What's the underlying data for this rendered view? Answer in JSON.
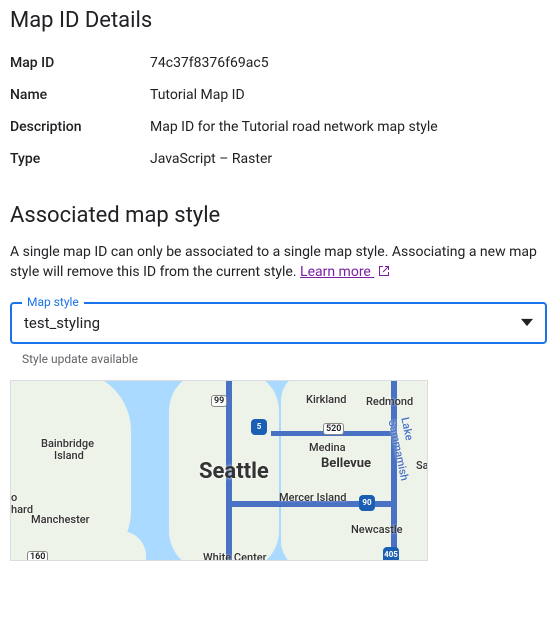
{
  "details": {
    "title": "Map ID Details",
    "rows": [
      {
        "label": "Map ID",
        "value": "74c37f8376f69ac5"
      },
      {
        "label": "Name",
        "value": "Tutorial Map ID"
      },
      {
        "label": "Description",
        "value": "Map ID for the Tutorial road network map style"
      },
      {
        "label": "Type",
        "value": "JavaScript – Raster"
      }
    ]
  },
  "associated": {
    "title": "Associated map style",
    "description": "A single map ID can only be associated to a single map style. Associating a new map style will remove this ID from the current style.",
    "learn_more": "Learn more",
    "select_legend": "Map style",
    "select_value": "test_styling",
    "helper": "Style update available"
  },
  "map": {
    "cities": {
      "seattle": "Seattle",
      "bellevue": "Bellevue",
      "kirkland": "Kirkland",
      "redmond": "Redmond",
      "medina": "Medina",
      "mercer": "Mercer Island",
      "newcastle": "Newcastle",
      "bainbridge1": "Bainbridge",
      "bainbridge2": "Island",
      "manchester": "Manchester",
      "whitecenter": "White Center",
      "sammamish": "Lake Sammamish",
      "hard": "hard",
      "o": "o",
      "sa": "Sa"
    },
    "shields": {
      "r99": "99",
      "r520": "520",
      "i5": "5",
      "i405": "405",
      "i90": "90",
      "r160": "160"
    }
  }
}
